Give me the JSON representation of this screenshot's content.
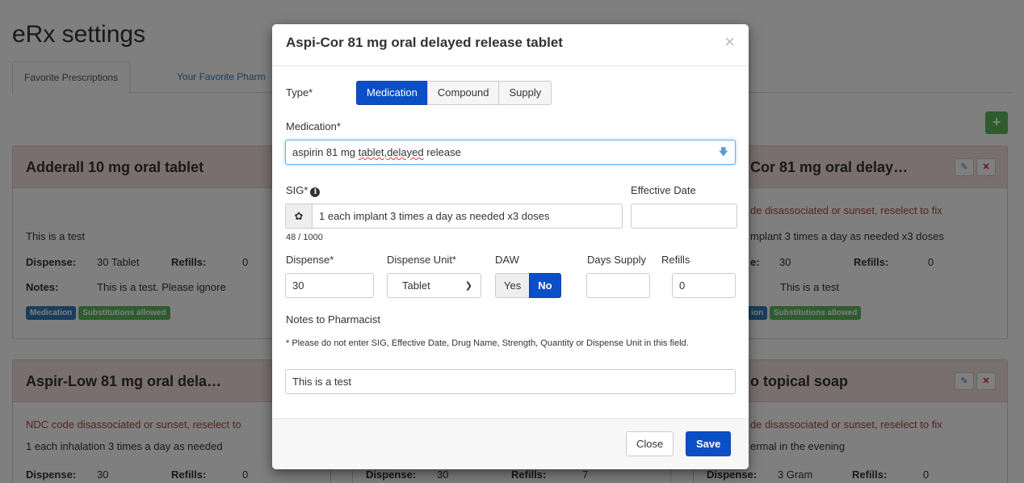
{
  "page": {
    "title": "eRx settings",
    "tabs": [
      "Favorite Prescriptions",
      "Your Favorite Pharm"
    ],
    "add_button": "+"
  },
  "cards": {
    "adderall": {
      "title": "Adderall 10 mg oral tablet",
      "sig": "This is a test",
      "dispense_label": "Dispense:",
      "dispense_value": "30 Tablet",
      "refills_label": "Refills:",
      "refills_value": "0",
      "notes_label": "Notes:",
      "notes_value": "This is a test. Please ignore",
      "badges": [
        "Medication",
        "Substitutions allowed"
      ]
    },
    "aspicor": {
      "title": "Cor 81 mg oral delay…",
      "warning": "de disassociated or sunset, reselect to fix",
      "sig": "mplant 3 times a day as needed x3 doses",
      "dispense_label": "e:",
      "dispense_value": "30",
      "refills_label": "Refills:",
      "refills_value": "0",
      "notes_value": "This is a test",
      "badges": [
        "ion",
        "Substitutions allowed"
      ]
    },
    "aspirlow": {
      "title": "Aspir-Low 81 mg oral dela…",
      "warning": "NDC code disassociated or sunset, reselect to",
      "sig": "1 each inhalation 3 times a day as needed",
      "dispense_label": "Dispense:",
      "dispense_value": "30",
      "refills_label": "Refills:",
      "refills_value": "0"
    },
    "middle": {
      "dispense_label": "Dispense:",
      "dispense_value": "30",
      "refills_label": "Refills:",
      "refills_value": "7"
    },
    "soap": {
      "title": "o topical soap",
      "warning": "de disassociated or sunset, reselect to fix",
      "sig": "ermal in the evening",
      "dispense_label": "Dispense:",
      "dispense_value": "3 Gram",
      "refills_label": "Refills:",
      "refills_value": "0"
    }
  },
  "modal": {
    "title": "Aspi-Cor 81 mg oral delayed release tablet",
    "close_symbol": "×",
    "type_label": "Type*",
    "type_options": [
      "Medication",
      "Compound",
      "Supply"
    ],
    "type_selected": "Medication",
    "medication_label": "Medication*",
    "medication_value_a": "aspirin 81 mg ",
    "medication_value_b": "tablet,delayed",
    "medication_value_c": " release",
    "sig_label": "SIG*",
    "sig_value": "1 each implant 3 times a day as needed  x3 doses",
    "sig_counter": "48 / 1000",
    "effective_date_label": "Effective Date",
    "effective_date_value": "",
    "dispense_label": "Dispense*",
    "dispense_value": "30",
    "dispense_unit_label": "Dispense Unit*",
    "dispense_unit_value": "Tablet",
    "daw_label": "DAW",
    "daw_yes": "Yes",
    "daw_no": "No",
    "daw_selected": "No",
    "days_supply_label": "Days Supply",
    "days_supply_value": "",
    "refills_label": "Refills",
    "refills_value": "0",
    "notes_label": "Notes to Pharmacist",
    "notes_hint": "* Please do not enter SIG, Effective Date, Drug Name, Strength, Quantity or Dispense Unit in this field.",
    "notes_value": "This is a test",
    "close_button": "Close",
    "save_button": "Save"
  },
  "colors": {
    "primary": "#0b4fc6",
    "success": "#5cb85c",
    "danger_bg": "#f2dede",
    "danger_text": "#a94442"
  },
  "icons": [
    "close-icon",
    "dropdown-arrow-icon",
    "info-icon",
    "gear-icon",
    "pencil-icon",
    "remove-icon",
    "plus-icon",
    "chevron-down-icon"
  ]
}
